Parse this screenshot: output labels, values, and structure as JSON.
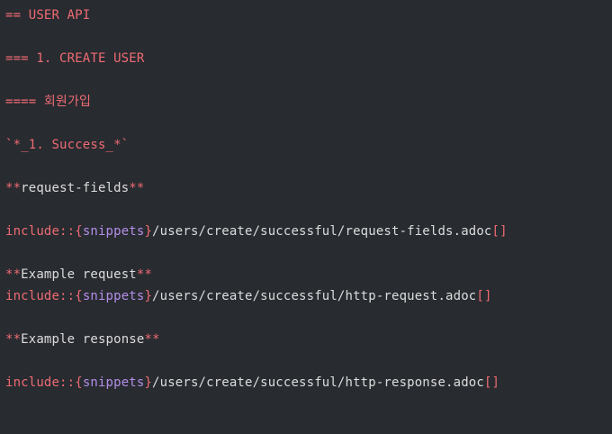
{
  "lines": {
    "l1": {
      "text": "== USER API"
    },
    "l2": {
      "text": "=== 1. CREATE USER"
    },
    "l3": {
      "text": "==== 회원가입"
    },
    "l4": {
      "text": "`*_1. Success_*`"
    },
    "l5": {
      "open": "**",
      "text": "request-fields",
      "close": "**"
    },
    "l6": {
      "prefix": "include::",
      "lbrace": "{",
      "attr": "snippets",
      "rbrace": "}",
      "path": "/users/create/successful/request-fields.adoc",
      "brackets": "[]"
    },
    "l7": {
      "open": "**",
      "text": "Example request",
      "close": "**"
    },
    "l8": {
      "prefix": "include::",
      "lbrace": "{",
      "attr": "snippets",
      "rbrace": "}",
      "path": "/users/create/successful/http-request.adoc",
      "brackets": "[]"
    },
    "l9": {
      "open": "**",
      "text": "Example response",
      "close": "**"
    },
    "l10": {
      "prefix": "include::",
      "lbrace": "{",
      "attr": "snippets",
      "rbrace": "}",
      "path": "/users/create/successful/http-response.adoc",
      "brackets": "[]"
    }
  },
  "colors": {
    "background": "#282b30",
    "heading": "#ef6b73",
    "attribute": "#b48ee8",
    "text": "#dcdcdc"
  }
}
